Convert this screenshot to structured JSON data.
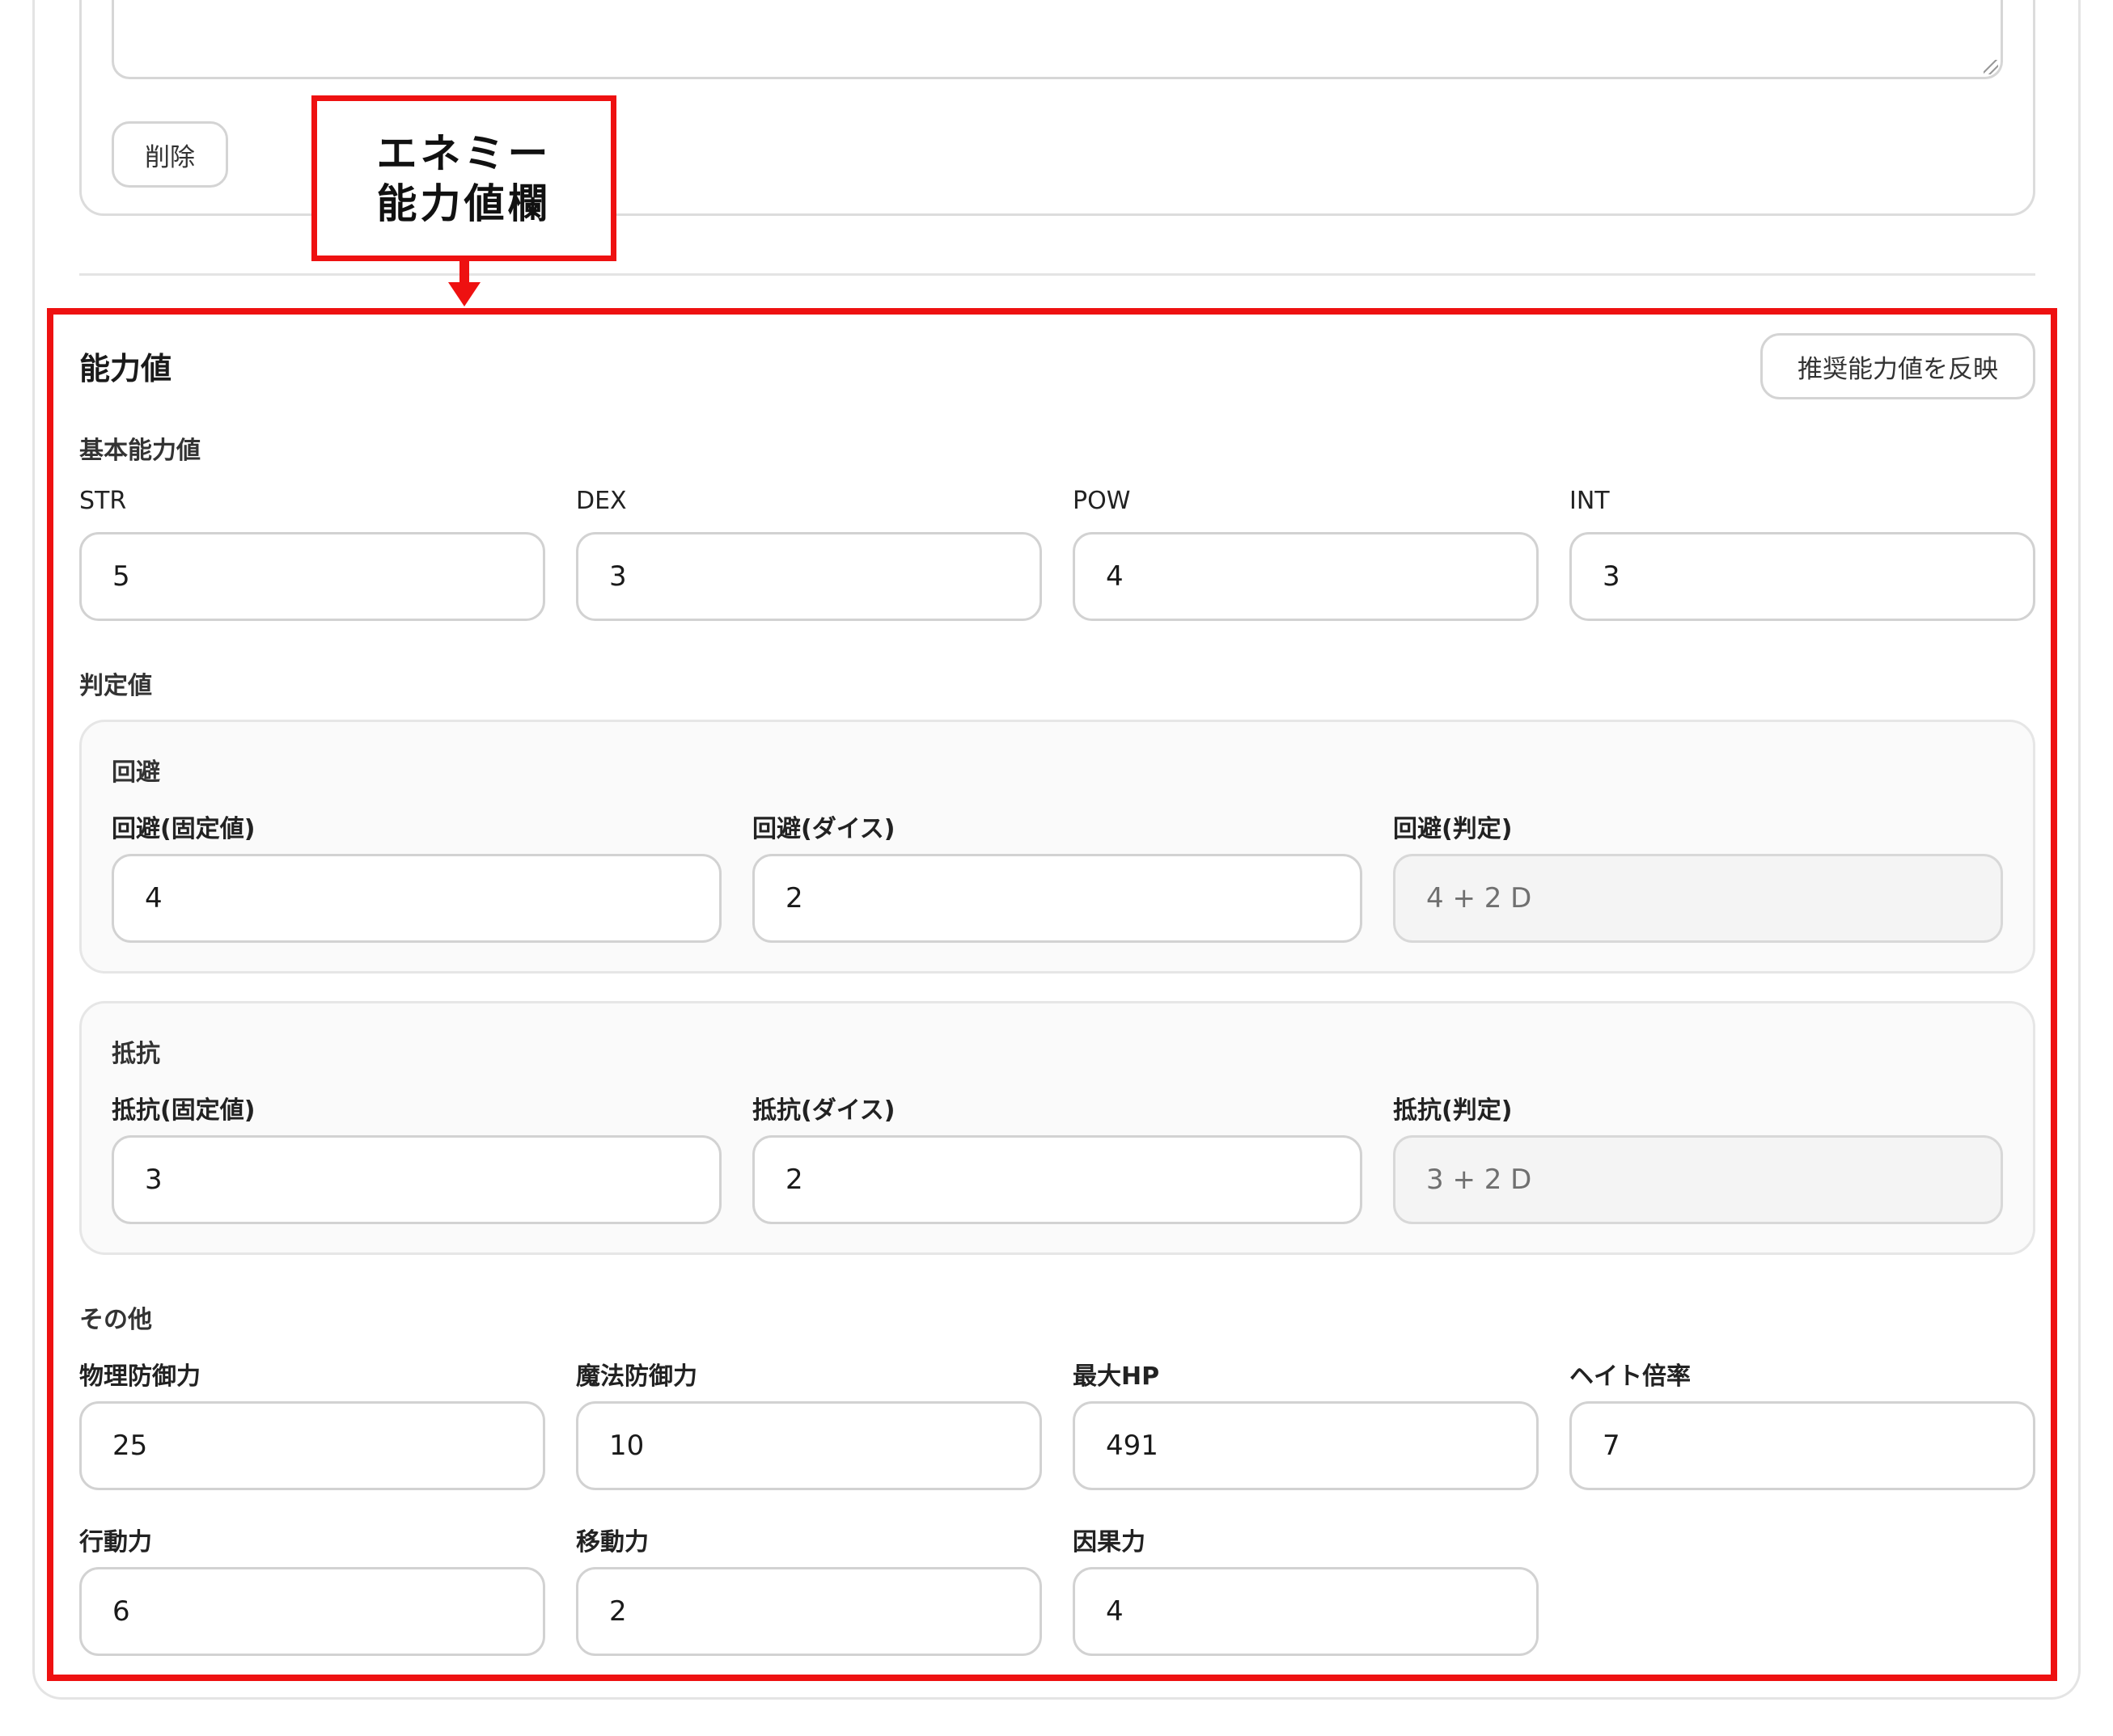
{
  "upper": {
    "delete_label": "削除"
  },
  "callout": {
    "line1": "エネミー",
    "line2": "能力値欄"
  },
  "abilities": {
    "title": "能力値",
    "reflect_button": "推奨能力値を反映",
    "basic": {
      "heading": "基本能力値",
      "fields": [
        {
          "label": "STR",
          "value": "5"
        },
        {
          "label": "DEX",
          "value": "3"
        },
        {
          "label": "POW",
          "value": "4"
        },
        {
          "label": "INT",
          "value": "3"
        }
      ]
    },
    "judgement": {
      "heading": "判定値",
      "evasion": {
        "heading": "回避",
        "fixed_label": "回避(固定値)",
        "fixed_value": "4",
        "dice_label": "回避(ダイス)",
        "dice_value": "2",
        "result_label": "回避(判定)",
        "result_value": "4 + 2 D"
      },
      "resistance": {
        "heading": "抵抗",
        "fixed_label": "抵抗(固定値)",
        "fixed_value": "3",
        "dice_label": "抵抗(ダイス)",
        "dice_value": "2",
        "result_label": "抵抗(判定)",
        "result_value": "3 + 2 D"
      }
    },
    "other": {
      "heading": "その他",
      "row1": [
        {
          "label": "物理防御力",
          "value": "25"
        },
        {
          "label": "魔法防御力",
          "value": "10"
        },
        {
          "label": "最大HP",
          "value": "491"
        },
        {
          "label": "ヘイト倍率",
          "value": "7"
        }
      ],
      "row2": [
        {
          "label": "行動力",
          "value": "6"
        },
        {
          "label": "移動力",
          "value": "2"
        },
        {
          "label": "因果力",
          "value": "4"
        }
      ]
    }
  }
}
